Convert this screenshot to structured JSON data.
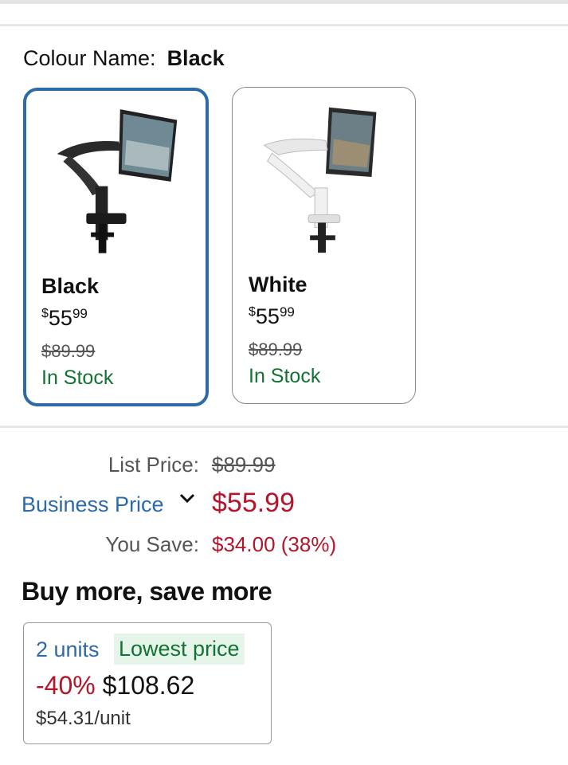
{
  "colour": {
    "label": "Colour Name:",
    "value": "Black"
  },
  "swatches": [
    {
      "name": "Black",
      "currency": "$",
      "whole": "55",
      "cents": "99",
      "list": "$89.99",
      "stock": "In Stock",
      "selected": true
    },
    {
      "name": "White",
      "currency": "$",
      "whole": "55",
      "cents": "99",
      "list": "$89.99",
      "stock": "In Stock",
      "selected": false
    }
  ],
  "pricing": {
    "list_label": "List Price:",
    "list_value": "$89.99",
    "business_label": "Business Price",
    "business_value": "$55.99",
    "save_label": "You Save:",
    "save_value": "$34.00 (38%)"
  },
  "bulk": {
    "title": "Buy more, save more",
    "units": "2 units",
    "badge": "Lowest price",
    "discount": "-40%",
    "total": "$108.62",
    "per_unit": "$54.31/unit"
  },
  "colors": {
    "accent_blue": "#2d6aa8",
    "price_red": "#b3162b",
    "stock_green": "#137333"
  }
}
